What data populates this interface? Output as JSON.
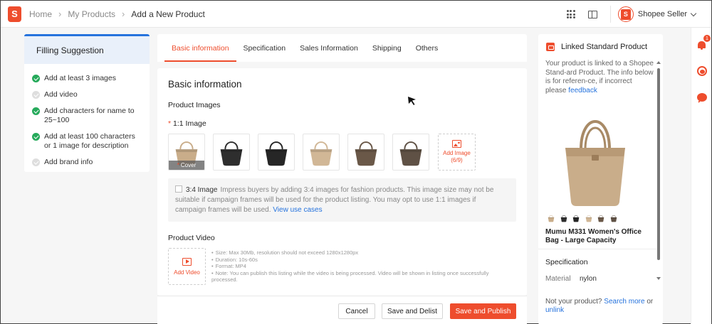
{
  "breadcrumb": {
    "items": [
      "Home",
      "My Products",
      "Add a New Product"
    ]
  },
  "account": {
    "name": "Shopee Seller"
  },
  "notifications": {
    "count": "1"
  },
  "suggestion": {
    "title": "Filling Suggestion",
    "items": [
      {
        "text": "Add at least 3 images",
        "done": true
      },
      {
        "text": "Add video",
        "done": false
      },
      {
        "text": "Add characters for name to 25~100",
        "done": true
      },
      {
        "text": "Add at least 100 characters or 1 image for description",
        "done": true
      },
      {
        "text": "Add brand info",
        "done": false
      }
    ]
  },
  "tabs": [
    {
      "label": "Basic information",
      "active": true
    },
    {
      "label": "Specification"
    },
    {
      "label": "Sales Information"
    },
    {
      "label": "Shipping"
    },
    {
      "label": "Others"
    }
  ],
  "basic": {
    "title": "Basic information",
    "product_images_label": "Product Images",
    "ratio_label": "1:1 Image",
    "required_mark": "*",
    "cover_label": "Cover",
    "add_image": {
      "label": "Add Image",
      "count": "(6/9)"
    },
    "bag_colors": [
      "#c9ad8a",
      "#2e2e2e",
      "#262626",
      "#d1b796",
      "#6a5848",
      "#5f5145"
    ],
    "info": {
      "checkbox_label": "3:4 Image",
      "text": "Impress buyers by adding 3:4 images for fashion products. This image size may not be suitable if campaign frames will be used for the product listing. You may opt to use 1:1 images if campaign frames will be used.",
      "link": "View use cases"
    },
    "video": {
      "label": "Product Video",
      "add_label": "Add Video",
      "notes": [
        "Size: Max 30Mb, resolution should not exceed 1280x1280px",
        "Duration: 10s-60s",
        "Format: MP4",
        "Note: You can publish this listing while the video is being processed. Video will be shown in listing once successfully processed."
      ]
    }
  },
  "footer": {
    "cancel": "Cancel",
    "save_delist": "Save and Delist",
    "save_publish": "Save and Publish"
  },
  "linked": {
    "title": "Linked Standard Product",
    "desc": "Your product is linked to a Shopee Stand-ard Product. The info below is for referen-ce, if incorrect please",
    "feedback_link": "feedback",
    "product_name": "Mumu M331 Women's Office Bag - Large Capacity",
    "spec_title": "Specification",
    "material_key": "Material",
    "material_value": "nylon",
    "not_yours": "Not your product?",
    "search_more": "Search more",
    "or": "or",
    "unlink": "unlink"
  },
  "colors": {
    "accent": "#ee4d2d",
    "link": "#2673dd",
    "success": "#26aa5b"
  }
}
